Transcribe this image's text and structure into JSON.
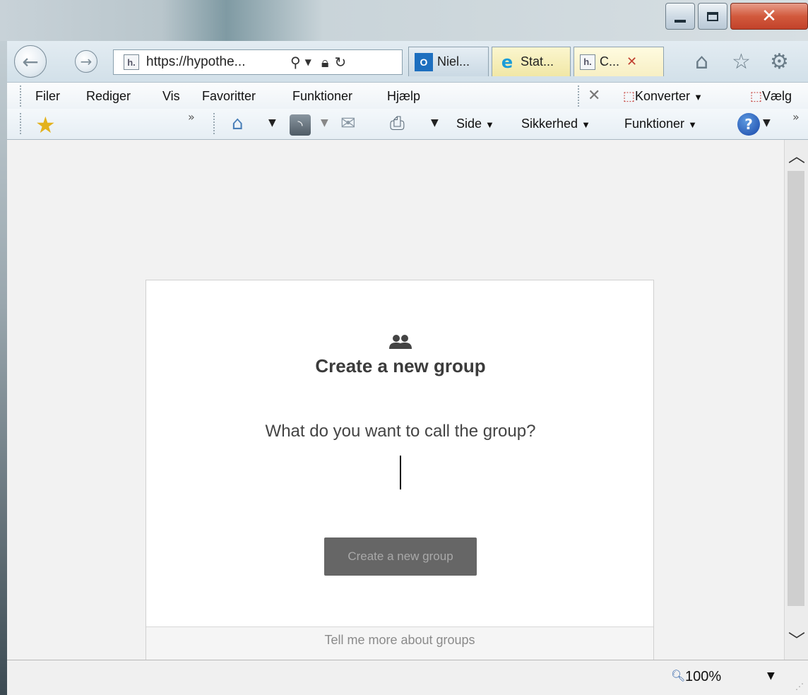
{
  "browser": {
    "address": {
      "url": "https://hypothe..."
    },
    "tabs": [
      {
        "label": "Niel..."
      },
      {
        "label": "Stat..."
      },
      {
        "label": "C..."
      }
    ],
    "menu": [
      "Filer",
      "Rediger",
      "Vis",
      "Favoritter",
      "Funktioner",
      "Hjælp"
    ],
    "pdf_toolbar": {
      "convert_label": "Konverter",
      "select_label": "Vælg"
    },
    "command_bar": {
      "page_label": "Side",
      "safety_label": "Sikkerhed",
      "tools_label": "Funktioner"
    },
    "status": {
      "zoom": "100%"
    }
  },
  "dialog": {
    "title": "Create a new group",
    "question": "What do you want to call the group?",
    "input_value": "",
    "submit_label": "Create a new group",
    "more_link": "Tell me more about groups"
  },
  "icons": {
    "back": "back-arrow-icon",
    "forward": "forward-arrow-icon",
    "search": "search-icon",
    "lock": "lock-icon",
    "refresh": "refresh-icon",
    "home": "home-icon",
    "favorites": "star-icon",
    "settings": "gear-icon",
    "group": "group-icon"
  },
  "colors": {
    "close_button": "#c2422a",
    "button_bg": "#666666",
    "button_text": "#a9a9a9",
    "title_text": "#3b3b3b"
  }
}
